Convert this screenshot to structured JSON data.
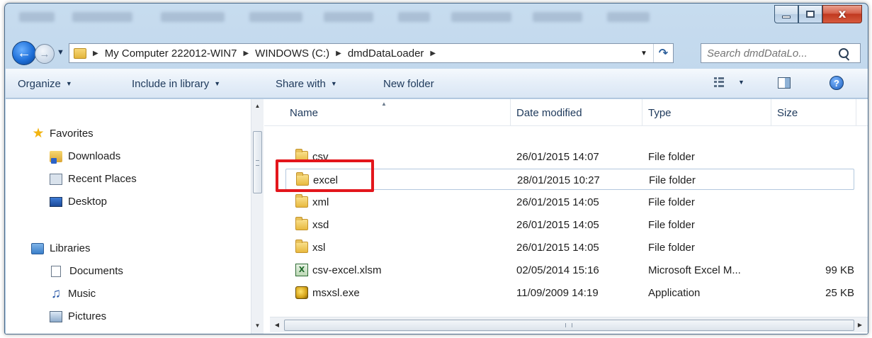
{
  "window": {
    "controls": {
      "close_glyph": "x"
    }
  },
  "address": {
    "segments": [
      "My Computer 222012-WIN7",
      "WINDOWS (C:)",
      "dmdDataLoader"
    ],
    "search_placeholder": "Search dmdDataLo..."
  },
  "toolbar": {
    "organize": "Organize",
    "include_in_library": "Include in library",
    "share_with": "Share with",
    "new_folder": "New folder"
  },
  "nav": {
    "favorites": "Favorites",
    "downloads": "Downloads",
    "recent_places": "Recent Places",
    "desktop": "Desktop",
    "libraries": "Libraries",
    "documents": "Documents",
    "music": "Music",
    "pictures": "Pictures"
  },
  "columns": {
    "name": "Name",
    "date_modified": "Date modified",
    "type": "Type",
    "size": "Size"
  },
  "files": [
    {
      "name": "csv",
      "date": "26/01/2015 14:07",
      "type": "File folder",
      "size": "",
      "icon": "folder-icon"
    },
    {
      "name": "excel",
      "date": "28/01/2015 10:27",
      "type": "File folder",
      "size": "",
      "icon": "folder-icon"
    },
    {
      "name": "xml",
      "date": "26/01/2015 14:05",
      "type": "File folder",
      "size": "",
      "icon": "folder-icon"
    },
    {
      "name": "xsd",
      "date": "26/01/2015 14:05",
      "type": "File folder",
      "size": "",
      "icon": "folder-icon"
    },
    {
      "name": "xsl",
      "date": "26/01/2015 14:05",
      "type": "File folder",
      "size": "",
      "icon": "folder-icon"
    },
    {
      "name": "csv-excel.xlsm",
      "date": "02/05/2014 15:16",
      "type": "Microsoft Excel M...",
      "size": "99 KB",
      "icon": "excel-file-icon"
    },
    {
      "name": "msxsl.exe",
      "date": "11/09/2009 14:19",
      "type": "Application",
      "size": "25 KB",
      "icon": "exe-file-icon"
    }
  ],
  "colors": {
    "highlight": "#e3161c",
    "accent": "#1e6fd8"
  }
}
